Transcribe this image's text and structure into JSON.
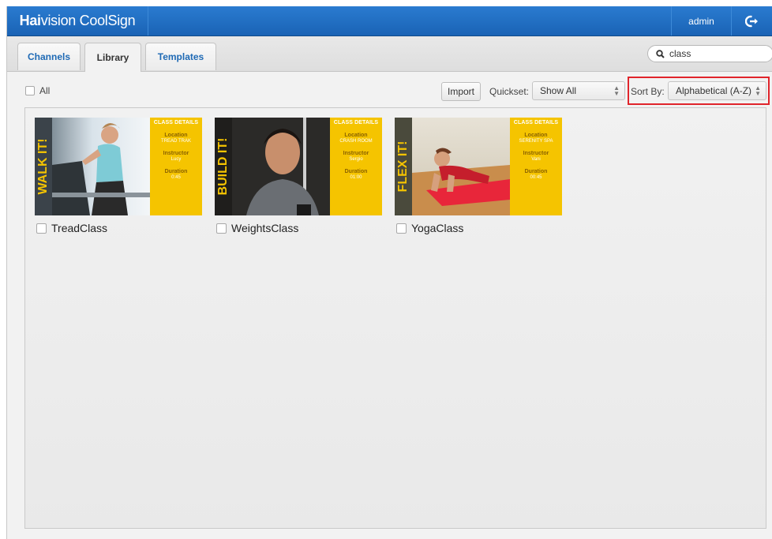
{
  "app": {
    "brand_prefix": "Hai",
    "brand_rest": "vision CoolSign",
    "user": "admin",
    "logout_icon": "logout-arrow-icon"
  },
  "tabs": [
    {
      "label": "Channels",
      "active": false
    },
    {
      "label": "Library",
      "active": true
    },
    {
      "label": "Templates",
      "active": false
    }
  ],
  "search": {
    "value": "class",
    "placeholder": "",
    "icon": "search-icon"
  },
  "toolbar": {
    "select_all_label": "All",
    "import_label": "Import",
    "quickset_label": "Quickset:",
    "quickset_value": "Show All",
    "sort_label": "Sort By:",
    "sort_value": "Alphabetical (A-Z)",
    "highlight_color": "#e0242b"
  },
  "items": [
    {
      "name": "TreadClass",
      "banner": "WALK IT!",
      "details_header": "CLASS DETAILS",
      "location_label": "Location",
      "location": "TREAD TRAK",
      "instructor_label": "Instructor",
      "instructor": "Lucy",
      "duration_label": "Duration",
      "duration": "0:45"
    },
    {
      "name": "WeightsClass",
      "banner": "BUILD IT!",
      "details_header": "CLASS DETAILS",
      "location_label": "Location",
      "location": "CRASH ROOM",
      "instructor_label": "Instructor",
      "instructor": "Sergio",
      "duration_label": "Duration",
      "duration": "01:00"
    },
    {
      "name": "YogaClass",
      "banner": "FLEX IT!",
      "details_header": "CLASS DETAILS",
      "location_label": "Location",
      "location": "SERENITY SPA",
      "instructor_label": "Instructor",
      "instructor": "Vani",
      "duration_label": "Duration",
      "duration": "00:45"
    }
  ],
  "colors": {
    "topbar": "#1f6fc4",
    "tab_text": "#1f6ab5",
    "accent_yellow": "#f5c400"
  }
}
